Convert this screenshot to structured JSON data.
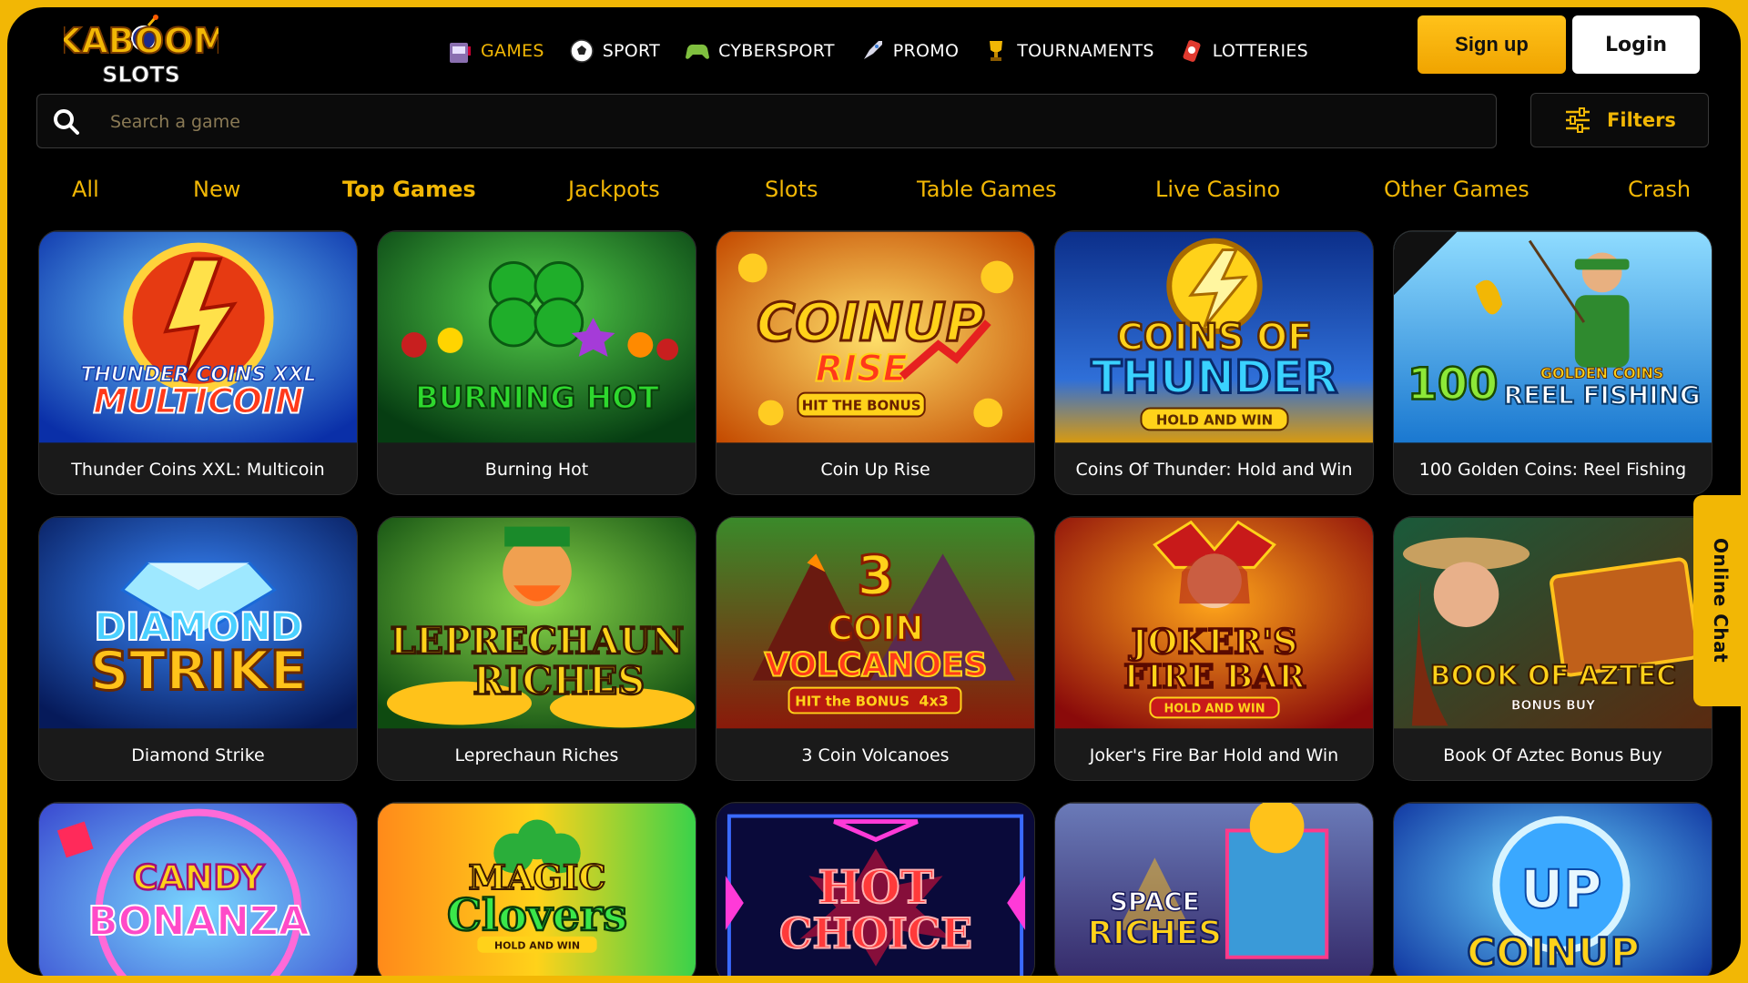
{
  "brand": {
    "logo_top": "KABOOM",
    "logo_bottom": "SLOTS"
  },
  "nav": [
    {
      "label": "GAMES",
      "icon": "slot-machine-icon",
      "active": true
    },
    {
      "label": "SPORT",
      "icon": "soccer-ball-icon"
    },
    {
      "label": "CYBERSPORT",
      "icon": "gamepad-icon"
    },
    {
      "label": "PROMO",
      "icon": "rocket-icon"
    },
    {
      "label": "TOURNAMENTS",
      "icon": "trophy-icon"
    },
    {
      "label": "LOTTERIES",
      "icon": "lottery-icon"
    }
  ],
  "auth": {
    "signup": "Sign up",
    "login": "Login"
  },
  "search": {
    "placeholder": "Search a game"
  },
  "filters": {
    "label": "Filters"
  },
  "categories": [
    {
      "label": "All"
    },
    {
      "label": "New"
    },
    {
      "label": "Top Games",
      "active": true
    },
    {
      "label": "Jackpots"
    },
    {
      "label": "Slots"
    },
    {
      "label": "Table Games"
    },
    {
      "label": "Live Casino"
    },
    {
      "label": "Other Games"
    },
    {
      "label": "Crash"
    }
  ],
  "games": [
    {
      "title": "Thunder Coins XXL: Multicoin",
      "art": [
        "THUNDER COINS XXL",
        "MULTICOIN"
      ]
    },
    {
      "title": "Burning Hot",
      "art": [
        "BURNING HOT"
      ]
    },
    {
      "title": "Coin Up Rise",
      "art": [
        "COINUP",
        "RISE",
        "HIT THE BONUS"
      ]
    },
    {
      "title": "Coins Of Thunder: Hold and Win",
      "art": [
        "COINS OF",
        "THUNDER",
        "HOLD AND WIN"
      ]
    },
    {
      "title": "100 Golden Coins: Reel Fishing",
      "art": [
        "100",
        "GOLDEN COINS",
        "REEL FISHING"
      ]
    },
    {
      "title": "Diamond Strike",
      "art": [
        "DIAMOND",
        "STRIKE"
      ]
    },
    {
      "title": "Leprechaun Riches",
      "art": [
        "LEPRECHAUN",
        "RICHES"
      ]
    },
    {
      "title": "3 Coin Volcanoes",
      "art": [
        "3",
        "COIN",
        "VOLCANOES",
        "HIT the BONUS",
        "4x3"
      ]
    },
    {
      "title": "Joker's Fire Bar Hold and Win",
      "art": [
        "JOKER'S",
        "FIRE BAR",
        "HOLD AND WIN"
      ]
    },
    {
      "title": "Book Of Aztec Bonus Buy",
      "art": [
        "BOOK OF AZTEC",
        "BONUS BUY"
      ]
    },
    {
      "title": "",
      "art": [
        "CANDY",
        "BONANZA"
      ]
    },
    {
      "title": "",
      "art": [
        "MAGIC",
        "Clovers",
        "HOLD AND WIN"
      ]
    },
    {
      "title": "",
      "art": [
        "HOT",
        "CHOICE"
      ]
    },
    {
      "title": "",
      "art": [
        "SPACE",
        "RICHES"
      ]
    },
    {
      "title": "",
      "art": [
        "UP",
        "COINUP"
      ]
    }
  ],
  "chat": {
    "label": "Online Chat"
  },
  "colors": {
    "accent": "#f2b705",
    "background": "#000000",
    "card": "#1a1a1a"
  }
}
